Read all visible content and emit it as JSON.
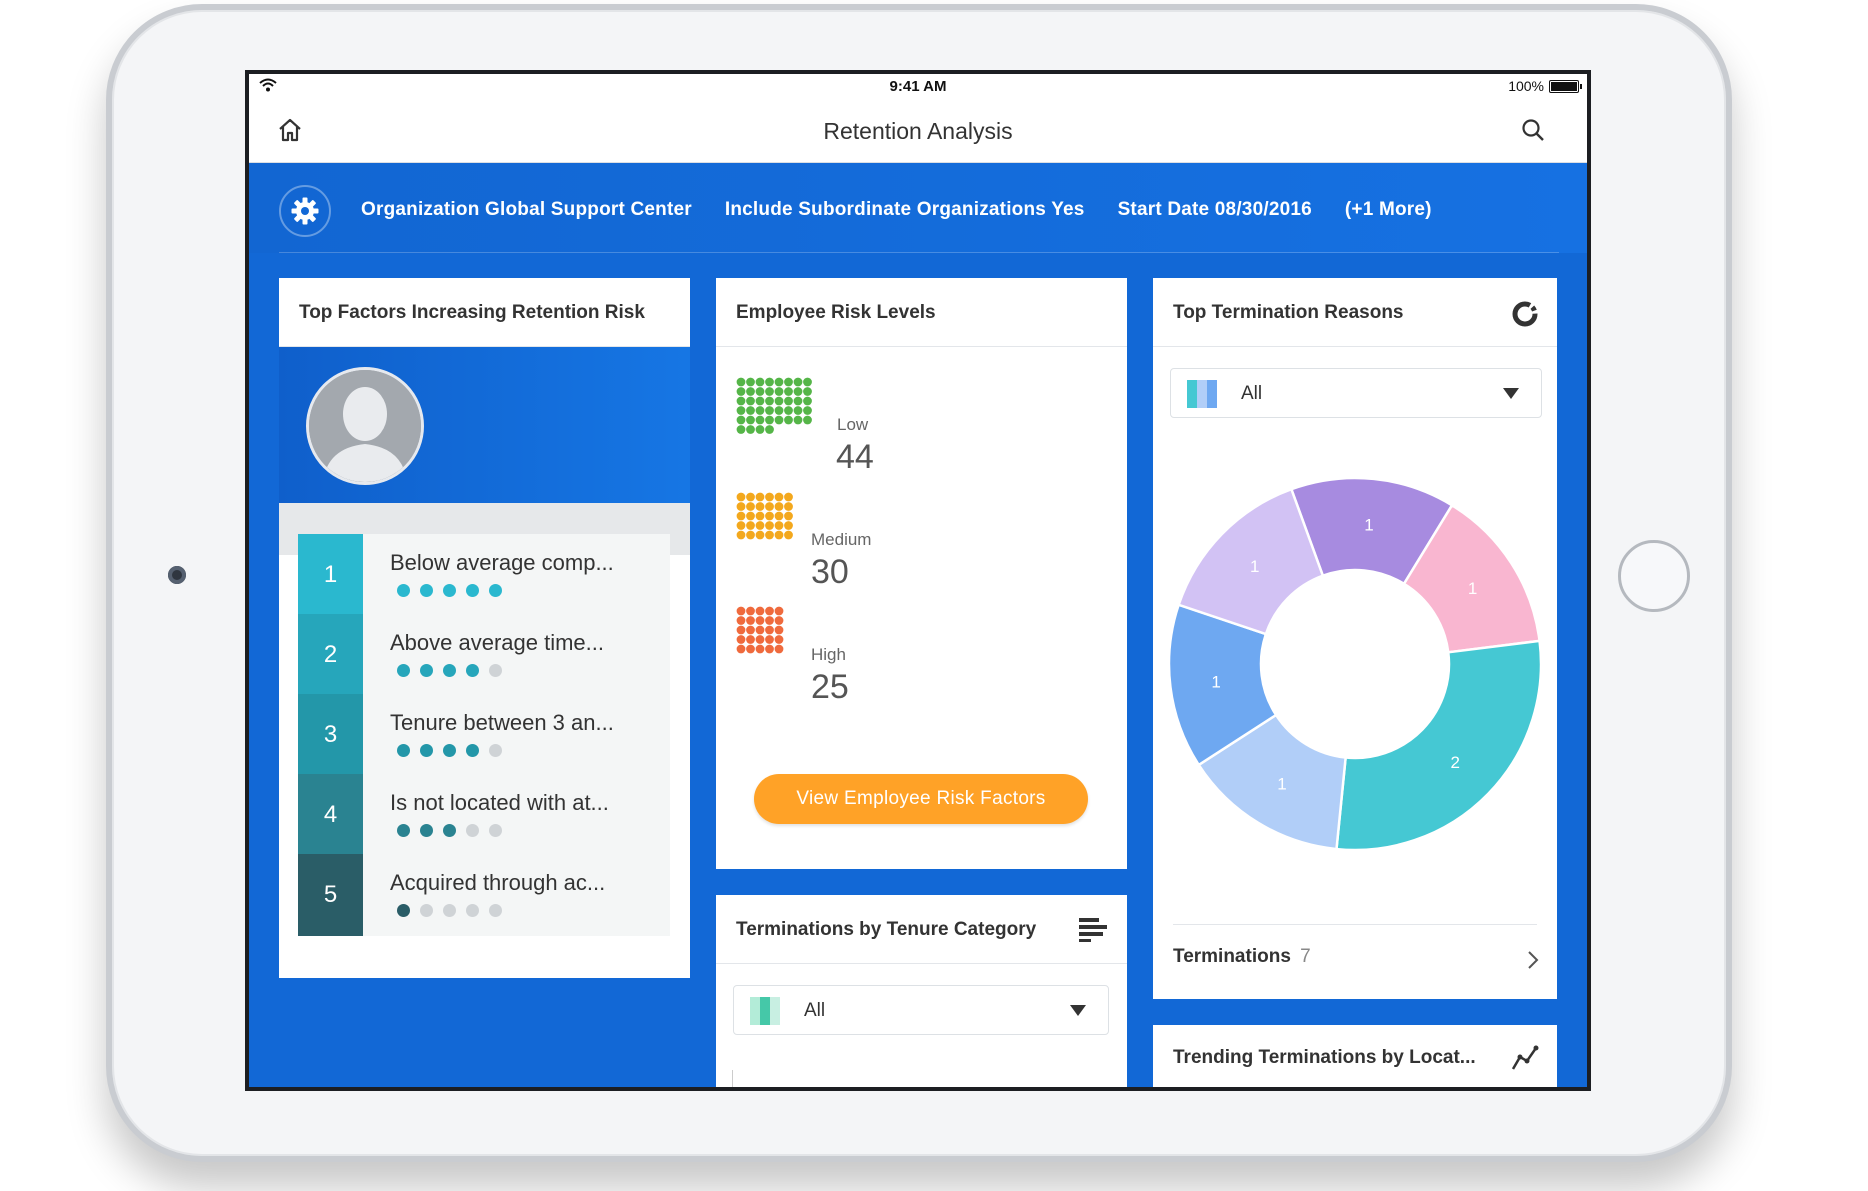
{
  "status_bar": {
    "time": "9:41 AM",
    "battery": "100%"
  },
  "nav": {
    "title": "Retention Analysis"
  },
  "filters": [
    "Organization Global Support Center",
    "Include Subordinate Organizations Yes",
    "Start Date 08/30/2016",
    "(+1 More)"
  ],
  "top_factors": {
    "title": "Top Factors Increasing Retention Risk",
    "items": [
      {
        "rank": "1",
        "label": "Below average comp...",
        "score": 5,
        "color": "#2ab8cf"
      },
      {
        "rank": "2",
        "label": "Above average time...",
        "score": 4,
        "color": "#26a6bb"
      },
      {
        "rank": "3",
        "label": "Tenure between 3 an...",
        "score": 4,
        "color": "#2397a9"
      },
      {
        "rank": "4",
        "label": "Is not located with at...",
        "score": 3,
        "color": "#2a8391"
      },
      {
        "rank": "5",
        "label": "Acquired through ac...",
        "score": 1,
        "color": "#2a5d67"
      }
    ]
  },
  "risk_levels": {
    "title": "Employee Risk Levels",
    "levels": [
      {
        "label": "Low",
        "value": "44",
        "color": "#55b548"
      },
      {
        "label": "Medium",
        "value": "30",
        "color": "#f3a81d"
      },
      {
        "label": "High",
        "value": "25",
        "color": "#ef6a3d"
      }
    ],
    "button": "View Employee Risk Factors"
  },
  "termination_reasons": {
    "title": "Top Termination Reasons",
    "select_value": "All",
    "footer_label": "Terminations",
    "footer_count": "7"
  },
  "chart_data": {
    "type": "pie",
    "title": "",
    "donut": true,
    "series": [
      {
        "value": 1,
        "color": "#a78be0"
      },
      {
        "value": 1,
        "color": "#f9b6d0"
      },
      {
        "value": 2,
        "color": "#45c8d3"
      },
      {
        "value": 1,
        "color": "#b1cef8"
      },
      {
        "value": 1,
        "color": "#6ea8f1"
      },
      {
        "value": 1,
        "color": "#d2c2f4"
      }
    ]
  },
  "tenure_card": {
    "title": "Terminations by Tenure Category",
    "select_value": "All"
  },
  "trending_card": {
    "title": "Trending Terminations by Locat..."
  },
  "colors": {
    "brand_blue": "#1268d6",
    "accent_orange": "#ffa227"
  }
}
